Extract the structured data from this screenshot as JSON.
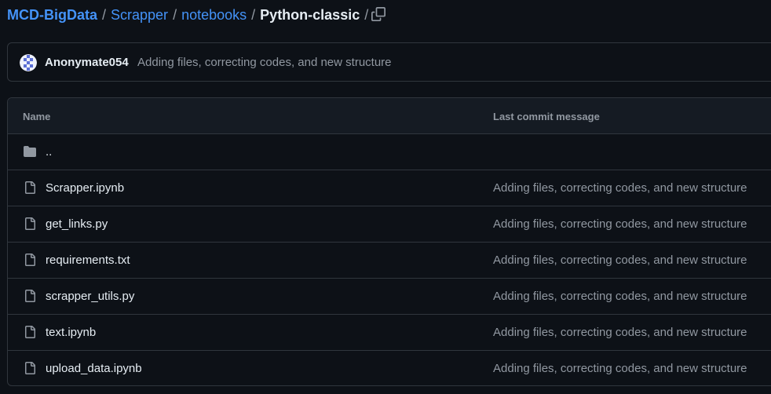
{
  "breadcrumb": {
    "repo": "MCD-BigData",
    "items": [
      "Scrapper",
      "notebooks"
    ],
    "current": "Python-classic",
    "separator": "/"
  },
  "icons": {
    "copy": "copy-icon",
    "folder": "folder-icon",
    "file": "file-icon"
  },
  "latest_commit": {
    "author": "Anonymate054",
    "message": "Adding files, correcting codes, and new structure"
  },
  "table": {
    "columns": [
      "Name",
      "Last commit message"
    ],
    "parent_dir": "..",
    "rows": [
      {
        "name": "Scrapper.ipynb",
        "message": "Adding files, correcting codes, and new structure"
      },
      {
        "name": "get_links.py",
        "message": "Adding files, correcting codes, and new structure"
      },
      {
        "name": "requirements.txt",
        "message": "Adding files, correcting codes, and new structure"
      },
      {
        "name": "scrapper_utils.py",
        "message": "Adding files, correcting codes, and new structure"
      },
      {
        "name": "text.ipynb",
        "message": "Adding files, correcting codes, and new structure"
      },
      {
        "name": "upload_data.ipynb",
        "message": "Adding files, correcting codes, and new structure"
      }
    ]
  },
  "colors": {
    "background": "#0d1117",
    "link": "#4493f8",
    "muted": "#9198a1",
    "border": "#30363d",
    "header_bg": "#151b23"
  }
}
